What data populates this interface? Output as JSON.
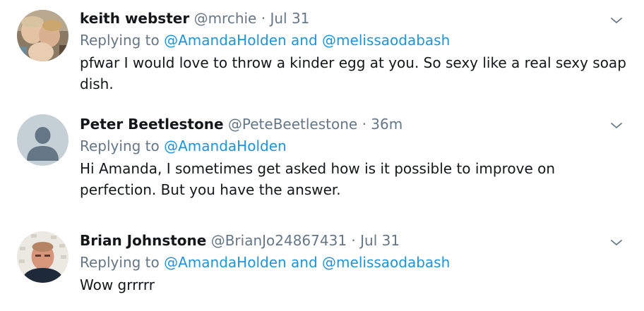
{
  "tweets": [
    {
      "name": "keith webster",
      "handle": "@mrchie",
      "separator": "·",
      "time": "Jul 31",
      "replying_prefix": "Replying to",
      "mention1": "@AmandaHolden",
      "conjunction": "and",
      "mention2": "@melissaodabash",
      "text": "pfwar I would love to throw a kinder egg at you. So sexy like a real sexy soap dish.",
      "avatar_icon": "family-photo-avatar",
      "menu_icon": "chevron-down-icon"
    },
    {
      "name": "Peter Beetlestone",
      "handle": "@PeteBeetlestone",
      "separator": "·",
      "time": "36m",
      "replying_prefix": "Replying to",
      "mention1": "@AmandaHolden",
      "text": "Hi Amanda, I sometimes get asked how is it possible to improve on perfection. But you have the answer.",
      "avatar_icon": "default-profile-avatar",
      "menu_icon": "chevron-down-icon"
    },
    {
      "name": "Brian Johnstone",
      "handle": "@BrianJo24867431",
      "separator": "·",
      "time": "Jul 31",
      "replying_prefix": "Replying to",
      "mention1": "@AmandaHolden",
      "conjunction": "and",
      "mention2": "@melissaodabash",
      "text": "Wow grrrrr",
      "avatar_icon": "man-photo-avatar",
      "menu_icon": "chevron-down-icon"
    }
  ],
  "colors": {
    "name": "#14171a",
    "secondary": "#657786",
    "link": "#1b95e0",
    "default_avatar_bg": "#c4cfd6"
  }
}
